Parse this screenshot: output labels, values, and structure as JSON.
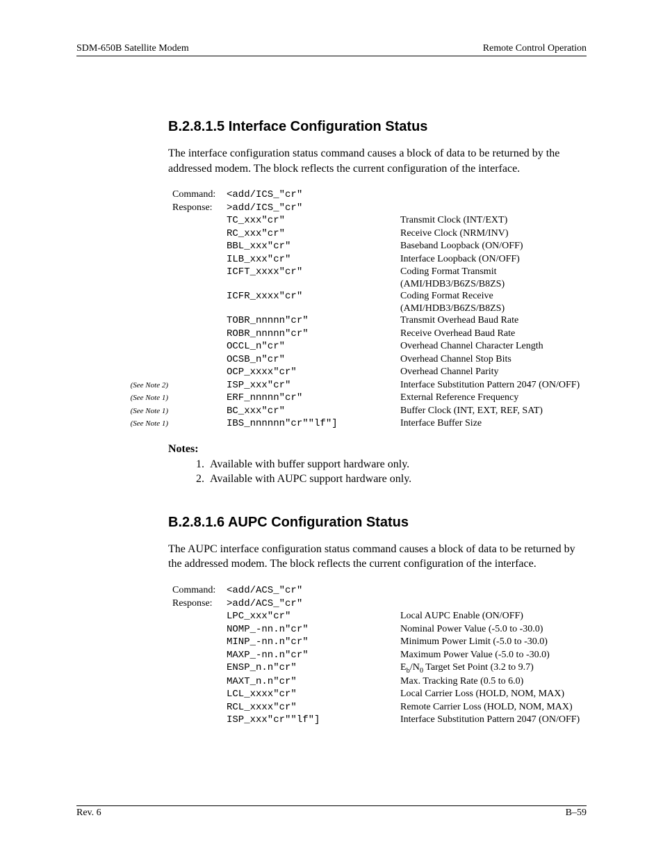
{
  "header": {
    "left": "SDM-650B Satellite Modem",
    "right": "Remote Control Operation"
  },
  "footer": {
    "left": "Rev. 6",
    "right": "B–59"
  },
  "section1": {
    "heading": "B.2.8.1.5  Interface Configuration Status",
    "para": "The interface configuration status command causes a block of data to be returned by the addressed modem. The block reflects the current configuration of the interface.",
    "rows": [
      {
        "note": "",
        "label": "Command:",
        "code": "<add/ICS_\"cr\"",
        "desc": ""
      },
      {
        "note": "",
        "label": "Response:",
        "code": ">add/ICS_\"cr\"",
        "desc": ""
      },
      {
        "note": "",
        "label": "",
        "code": "TC_xxx\"cr\"",
        "desc": "Transmit Clock (INT/EXT)"
      },
      {
        "note": "",
        "label": "",
        "code": "RC_xxx\"cr\"",
        "desc": "Receive Clock (NRM/INV)"
      },
      {
        "note": "",
        "label": "",
        "code": "BBL_xxx\"cr\"",
        "desc": "Baseband Loopback (ON/OFF)"
      },
      {
        "note": "",
        "label": "",
        "code": "ILB_xxx\"cr\"",
        "desc": "Interface Loopback (ON/OFF)"
      },
      {
        "note": "",
        "label": "",
        "code": "ICFT_xxxx\"cr\"",
        "desc": "Coding Format Transmit (AMI/HDB3/B6ZS/B8ZS)"
      },
      {
        "note": "",
        "label": "",
        "code": "ICFR_xxxx\"cr\"",
        "desc": "Coding Format Receive (AMI/HDB3/B6ZS/B8ZS)"
      },
      {
        "note": "",
        "label": "",
        "code": "TOBR_nnnnn\"cr\"",
        "desc": "Transmit Overhead Baud Rate"
      },
      {
        "note": "",
        "label": "",
        "code": "ROBR_nnnnn\"cr\"",
        "desc": "Receive Overhead Baud Rate"
      },
      {
        "note": "",
        "label": "",
        "code": "OCCL_n\"cr\"",
        "desc": "Overhead Channel Character Length"
      },
      {
        "note": "",
        "label": "",
        "code": "OCSB_n\"cr\"",
        "desc": "Overhead Channel Stop Bits"
      },
      {
        "note": "",
        "label": "",
        "code": "OCP_xxxx\"cr\"",
        "desc": "Overhead Channel Parity"
      },
      {
        "note": "(See Note 2)",
        "label": "",
        "code": "ISP_xxx\"cr\"",
        "desc": "Interface Substitution Pattern 2047 (ON/OFF)"
      },
      {
        "note": "(See Note 1)",
        "label": "",
        "code": "ERF_nnnnn\"cr\"",
        "desc": "External Reference Frequency"
      },
      {
        "note": "(See Note 1)",
        "label": "",
        "code": "BC_xxx\"cr\"",
        "desc": "Buffer Clock (INT, EXT, REF, SAT)"
      },
      {
        "note": "(See Note 1)",
        "label": "",
        "code": "IBS_nnnnnn\"cr\"\"lf\"]",
        "desc": "Interface Buffer Size"
      }
    ],
    "notes_heading": "Notes:",
    "notes": [
      "Available with buffer support hardware only.",
      "Available with AUPC support hardware only."
    ]
  },
  "section2": {
    "heading": "B.2.8.1.6  AUPC Configuration Status",
    "para": "The AUPC interface configuration status command causes a block of data to be returned by the addressed modem. The block reflects the current configuration of the interface.",
    "rows": [
      {
        "note": "",
        "label": "Command:",
        "code": "<add/ACS_\"cr\"",
        "desc": ""
      },
      {
        "note": "",
        "label": "Response:",
        "code": ">add/ACS_\"cr\"",
        "desc": ""
      },
      {
        "note": "",
        "label": "",
        "code": "LPC_xxx\"cr\"",
        "desc": "Local AUPC Enable (ON/OFF)"
      },
      {
        "note": "",
        "label": "",
        "code": "NOMP_-nn.n\"cr\"",
        "desc": "Nominal Power Value (-5.0 to -30.0)"
      },
      {
        "note": "",
        "label": "",
        "code": "MINP_-nn.n\"cr\"",
        "desc": "Minimum Power Limit (-5.0 to -30.0)"
      },
      {
        "note": "",
        "label": "",
        "code": "MAXP_-nn.n\"cr\"",
        "desc": "Maximum Power Value (-5.0 to -30.0)"
      },
      {
        "note": "",
        "label": "",
        "code": "ENSP_n.n\"cr\"",
        "desc": "__EBNO__"
      },
      {
        "note": "",
        "label": "",
        "code": "MAXT_n.n\"cr\"",
        "desc": "Max. Tracking Rate (0.5 to 6.0)"
      },
      {
        "note": "",
        "label": "",
        "code": "LCL_xxxx\"cr\"",
        "desc": "Local Carrier Loss (HOLD, NOM, MAX)"
      },
      {
        "note": "",
        "label": "",
        "code": "RCL_xxxx\"cr\"",
        "desc": "Remote Carrier Loss (HOLD, NOM, MAX)"
      },
      {
        "note": "",
        "label": "",
        "code": "ISP_xxx\"cr\"\"lf\"]",
        "desc": "Interface Substitution Pattern 2047 (ON/OFF)"
      }
    ]
  }
}
